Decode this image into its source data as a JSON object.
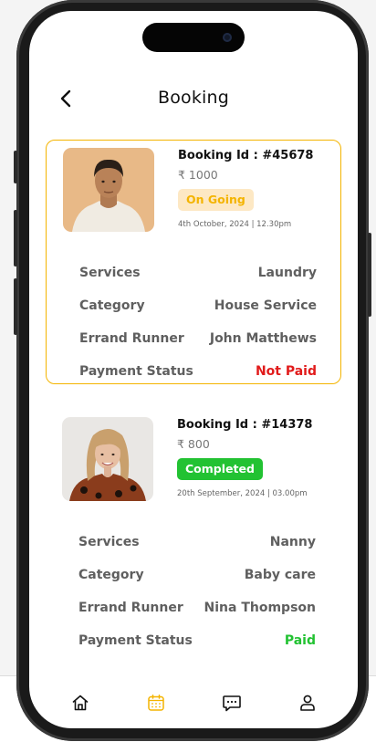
{
  "header": {
    "title": "Booking"
  },
  "colors": {
    "accent": "#f4b400",
    "ongoing_bg": "#fde8c4",
    "ongoing_text": "#f4b400",
    "completed_bg": "#22c232",
    "completed_text": "#ffffff",
    "not_paid": "#e11b1b",
    "paid": "#22c232"
  },
  "bookings": [
    {
      "id": "Booking Id : #45678",
      "price": "₹ 1000",
      "status": "On Going",
      "date": "4th October, 2024 | 12.30pm",
      "rows": [
        {
          "label": "Services",
          "value": "Laundry"
        },
        {
          "label": "Category",
          "value": "House Service"
        },
        {
          "label": "Errand Runner",
          "value": "John Matthews"
        },
        {
          "label": "Payment Status",
          "value": "Not Paid"
        }
      ]
    },
    {
      "id": "Booking Id : #14378",
      "price": "₹ 800",
      "status": "Completed",
      "date": "20th September, 2024 | 03.00pm",
      "rows": [
        {
          "label": "Services",
          "value": "Nanny"
        },
        {
          "label": "Category",
          "value": "Baby care"
        },
        {
          "label": "Errand Runner",
          "value": "Nina Thompson"
        },
        {
          "label": "Payment Status",
          "value": "Paid"
        }
      ]
    }
  ],
  "nav": [
    {
      "icon": "home-icon",
      "active": false
    },
    {
      "icon": "calendar-icon",
      "active": true
    },
    {
      "icon": "chat-icon",
      "active": false
    },
    {
      "icon": "profile-icon",
      "active": false
    }
  ]
}
